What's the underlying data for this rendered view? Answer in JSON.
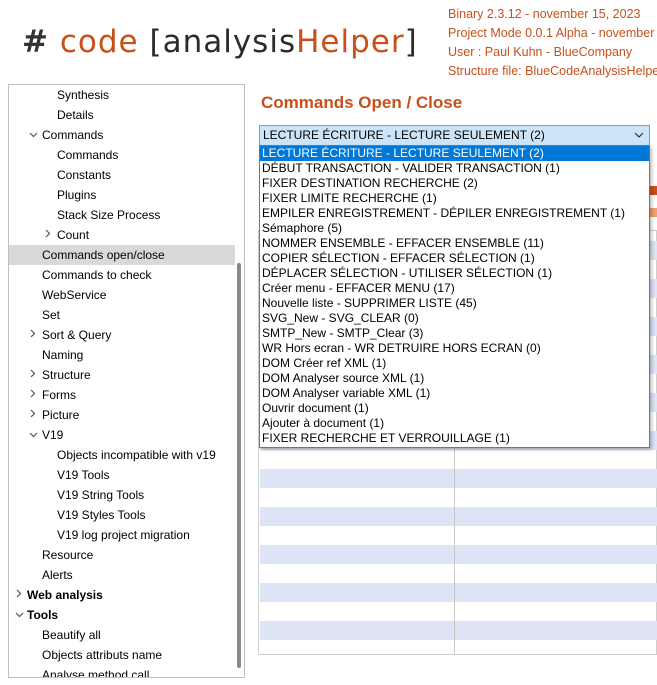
{
  "header": {
    "logo": {
      "hash": "#",
      "code": "code",
      "open": "[",
      "analysis": "analysis",
      "helper": "Helper",
      "close": "]"
    },
    "info_lines": [
      "Binary 2.3.12 - november 15, 2023",
      "Project Mode 0.0.1 Alpha - november",
      "User : Paul Kuhn - BlueCompany",
      "Structure file: BlueCodeAnalysisHelper"
    ]
  },
  "sidebar": {
    "items": [
      {
        "label": "Synthesis",
        "indent": 2,
        "chevron": "",
        "selected": false,
        "bold": false
      },
      {
        "label": "Details",
        "indent": 2,
        "chevron": "",
        "selected": false,
        "bold": false
      },
      {
        "label": "Commands",
        "indent": 1,
        "chevron": "expanded",
        "selected": false,
        "bold": false
      },
      {
        "label": "Commands",
        "indent": 2,
        "chevron": "",
        "selected": false,
        "bold": false
      },
      {
        "label": "Constants",
        "indent": 2,
        "chevron": "",
        "selected": false,
        "bold": false
      },
      {
        "label": "Plugins",
        "indent": 2,
        "chevron": "",
        "selected": false,
        "bold": false
      },
      {
        "label": "Stack Size Process",
        "indent": 2,
        "chevron": "",
        "selected": false,
        "bold": false
      },
      {
        "label": "Count",
        "indent": 2,
        "chevron": "collapsed",
        "selected": false,
        "bold": false
      },
      {
        "label": "Commands open/close",
        "indent": 1,
        "chevron": "",
        "selected": true,
        "bold": false
      },
      {
        "label": "Commands to check",
        "indent": 1,
        "chevron": "",
        "selected": false,
        "bold": false
      },
      {
        "label": "WebService",
        "indent": 1,
        "chevron": "",
        "selected": false,
        "bold": false
      },
      {
        "label": "Set",
        "indent": 1,
        "chevron": "",
        "selected": false,
        "bold": false
      },
      {
        "label": "Sort & Query",
        "indent": 1,
        "chevron": "collapsed",
        "selected": false,
        "bold": false
      },
      {
        "label": "Naming",
        "indent": 1,
        "chevron": "",
        "selected": false,
        "bold": false
      },
      {
        "label": "Structure",
        "indent": 1,
        "chevron": "collapsed",
        "selected": false,
        "bold": false
      },
      {
        "label": "Forms",
        "indent": 1,
        "chevron": "collapsed",
        "selected": false,
        "bold": false
      },
      {
        "label": "Picture",
        "indent": 1,
        "chevron": "collapsed",
        "selected": false,
        "bold": false
      },
      {
        "label": "V19",
        "indent": 1,
        "chevron": "expanded",
        "selected": false,
        "bold": false
      },
      {
        "label": "Objects incompatible with v19",
        "indent": 2,
        "chevron": "",
        "selected": false,
        "bold": false
      },
      {
        "label": "V19 Tools",
        "indent": 2,
        "chevron": "",
        "selected": false,
        "bold": false
      },
      {
        "label": "V19 String Tools",
        "indent": 2,
        "chevron": "",
        "selected": false,
        "bold": false
      },
      {
        "label": "V19 Styles Tools",
        "indent": 2,
        "chevron": "",
        "selected": false,
        "bold": false
      },
      {
        "label": "V19 log project migration",
        "indent": 2,
        "chevron": "",
        "selected": false,
        "bold": false
      },
      {
        "label": "Resource",
        "indent": 1,
        "chevron": "",
        "selected": false,
        "bold": false
      },
      {
        "label": "Alerts",
        "indent": 1,
        "chevron": "",
        "selected": false,
        "bold": false
      },
      {
        "label": "Web analysis",
        "indent": 0,
        "chevron": "collapsed",
        "selected": false,
        "bold": true
      },
      {
        "label": "Tools",
        "indent": 0,
        "chevron": "expanded",
        "selected": false,
        "bold": true
      },
      {
        "label": "Beautify all",
        "indent": 1,
        "chevron": "",
        "selected": false,
        "bold": false
      },
      {
        "label": "Objects attributs name",
        "indent": 1,
        "chevron": "",
        "selected": false,
        "bold": false
      },
      {
        "label": "Analyse method call",
        "indent": 1,
        "chevron": "",
        "selected": false,
        "bold": false
      }
    ]
  },
  "main": {
    "title": "Commands Open / Close",
    "combo": {
      "value": "LECTURE ÉCRITURE - LECTURE SEULEMENT  (2)",
      "options": [
        "LECTURE ÉCRITURE - LECTURE SEULEMENT  (2)",
        "DÉBUT TRANSACTION - VALIDER TRANSACTION  (1)",
        "FIXER DESTINATION RECHERCHE  (2)",
        "FIXER LIMITE RECHERCHE  (1)",
        "EMPILER ENREGISTREMENT - DÉPILER ENREGISTREMENT  (1)",
        "Sémaphore  (5)",
        "NOMMER ENSEMBLE - EFFACER ENSEMBLE  (11)",
        "COPIER SÉLECTION - EFFACER SÉLECTION  (1)",
        "DÉPLACER SÉLECTION - UTILISER SÉLECTION  (1)",
        "Créer menu - EFFACER MENU  (17)",
        "Nouvelle liste - SUPPRIMER LISTE  (45)",
        "SVG_New - SVG_CLEAR  (0)",
        "SMTP_New - SMTP_Clear  (3)",
        "WR Hors ecran - WR DETRUIRE HORS ECRAN  (0)",
        "DOM Créer ref XML  (1)",
        "DOM Analyser source XML  (1)",
        "DOM Analyser variable XML  (1)",
        "Ouvrir document  (1)",
        "Ajouter à document  (1)",
        "FIXER RECHERCHE ET VERROUILLAGE  (1)"
      ],
      "selected_index": 0
    }
  },
  "colors": {
    "accent": "#c8501a",
    "selection": "#0078d7",
    "combo_bg": "#cce4f7",
    "stripe": "#dde4f6",
    "sidebar_selected": "#d9d9d9"
  },
  "icons": {
    "expanded": "chevron-down-icon",
    "collapsed": "chevron-right-icon",
    "dropdown": "chevron-down-icon"
  }
}
